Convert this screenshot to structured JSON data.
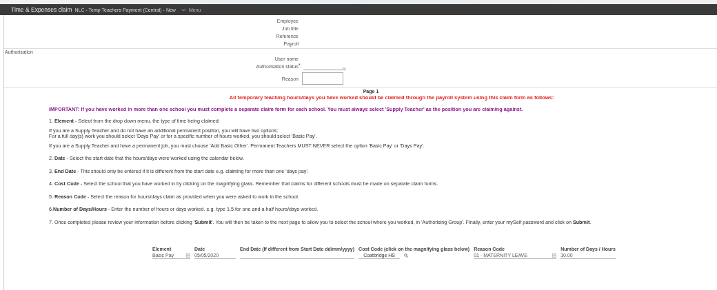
{
  "header": {
    "title": "Time & Expenses claim",
    "subtitle": "NLC - Temp Teachers Payment (Central) - New",
    "menu": "Menu"
  },
  "details": [
    {
      "label": "Employee"
    },
    {
      "label": "Job title"
    },
    {
      "label": "Reference"
    },
    {
      "label": "Payroll"
    }
  ],
  "authorisation": {
    "heading": "Authorisation",
    "user_name_label": "User name",
    "status_label": "Authorisation status",
    "required_mark": "*",
    "reason_label": "Reason"
  },
  "page_label": "Page 1",
  "headline": "All temporary teaching hours/days you have worked should be claimed through the payroll system using this claim form as follows:",
  "important": "IMPORTANT: If you have worked in more than one school you must complete a separate claim form for each school. You must always select 'Supply Teacher' as the position you are claiming against.",
  "instructions": [
    {
      "kind": "step",
      "lines": [
        "1. **Element** - Select from the drop down menu, the type of time being claimed:"
      ]
    },
    {
      "kind": "note",
      "lines": [
        "If you are a Supply Teacher and do not have an additional permanent position, you will have two options:",
        "For a full day(s) work you should select 'Days Pay' or for a specific number of hours worked, you should select 'Basic Pay'."
      ]
    },
    {
      "kind": "note",
      "lines": [
        "If you are a Supply Teacher and have a permanent job, you must choose 'Add Basic Other'. Permanent Teachers MUST NEVER select the option 'Basic Pay' or 'Days Pay'."
      ]
    },
    {
      "kind": "step",
      "lines": [
        "2. **Date** - Select the start date that the hours/days were worked using the calendar below."
      ]
    },
    {
      "kind": "step",
      "lines": [
        "3. **End Date** - This should only be entered if it is different from the start date e.g. claiming for more than one 'days pay'."
      ]
    },
    {
      "kind": "step",
      "lines": [
        "4. **Cost Code** - Select the school that you have worked in by clicking on the magnifying glass. Remember that claims for different schools must be made on separate claim forms."
      ]
    },
    {
      "kind": "step",
      "lines": [
        "5. **Reason Code** - Select the reason for hours/days claim as provided when you were asked to work in the school."
      ]
    },
    {
      "kind": "step",
      "lines": [
        "6.**Number of Days/Hours** - Enter the number of hours or days worked. e.g. type 1.5 for one and a half hours/days worked."
      ]
    },
    {
      "kind": "step",
      "lines": [
        "7. Once completed please review your information before clicking **'Submit'**. You will then be taken to the next page to allow you to select the school where you worked, in 'Authorising Group'. Finally, enter your mySelf password and click on **Submit**."
      ]
    }
  ],
  "claim_columns": [
    {
      "kind": "select",
      "heading": "Element",
      "value": "Basic Pay"
    },
    {
      "kind": "date",
      "heading": "Date",
      "value": "05/05/2020"
    },
    {
      "kind": "text",
      "heading": "End Date (If different from Start Date dd/mm/yyyy)"
    },
    {
      "kind": "lookup",
      "heading": "Cost Code (click on the magnifying glass below)",
      "value": "Coatbridge HS"
    },
    {
      "kind": "text_select",
      "heading": "Reason Code",
      "value": "01 - MATERNITY LEAVE"
    },
    {
      "kind": "number",
      "heading": "Number of Days / Hours",
      "value": "10.00"
    }
  ]
}
